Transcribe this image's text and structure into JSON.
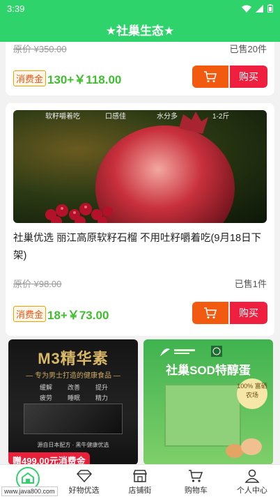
{
  "status_bar": {
    "time": "3:39"
  },
  "header": {
    "title": "★社巢生态★"
  },
  "products": [
    {
      "original_price": "原价 ¥350.00",
      "sold": "已售20件",
      "voucher_label": "消费金",
      "price": "130+￥118.00",
      "buy_label": "购买"
    },
    {
      "image_captions": [
        "软籽嚼着吃",
        "口感佳",
        "水分多",
        "1-2斤"
      ],
      "title": "社巢优选 丽江高原软籽石榴 不用吐籽嚼着吃(9月18日下架)",
      "original_price": "原价 ¥98.00",
      "sold": "已售1件",
      "voucher_label": "消费金",
      "price": "18+￥73.00",
      "buy_label": "购买"
    }
  ],
  "promos": [
    {
      "title": "M3精华素",
      "subtitle": "— 专为男士打造的健康食品 —",
      "features": [
        "缓解",
        "改善",
        "提升",
        "疲劳",
        "睡眠",
        "精力"
      ],
      "footer": "源自日本配方 · 黑牛健康优选",
      "gift": "赠499.00元消费金"
    },
    {
      "title": "社巢SOD特醇蛋",
      "badge": "100% 富硒农场"
    }
  ],
  "bottom_nav": {
    "items": [
      {
        "label": ""
      },
      {
        "label": "好物优选"
      },
      {
        "label": "店铺街"
      },
      {
        "label": "购物车"
      },
      {
        "label": "个人中心"
      }
    ]
  },
  "watermark": "www.java800.com",
  "colors": {
    "brand_green": "#2fd36b",
    "price_green": "#3fbf2d",
    "cart_orange": "#f25a10",
    "buy_red": "#ee1f3f"
  }
}
